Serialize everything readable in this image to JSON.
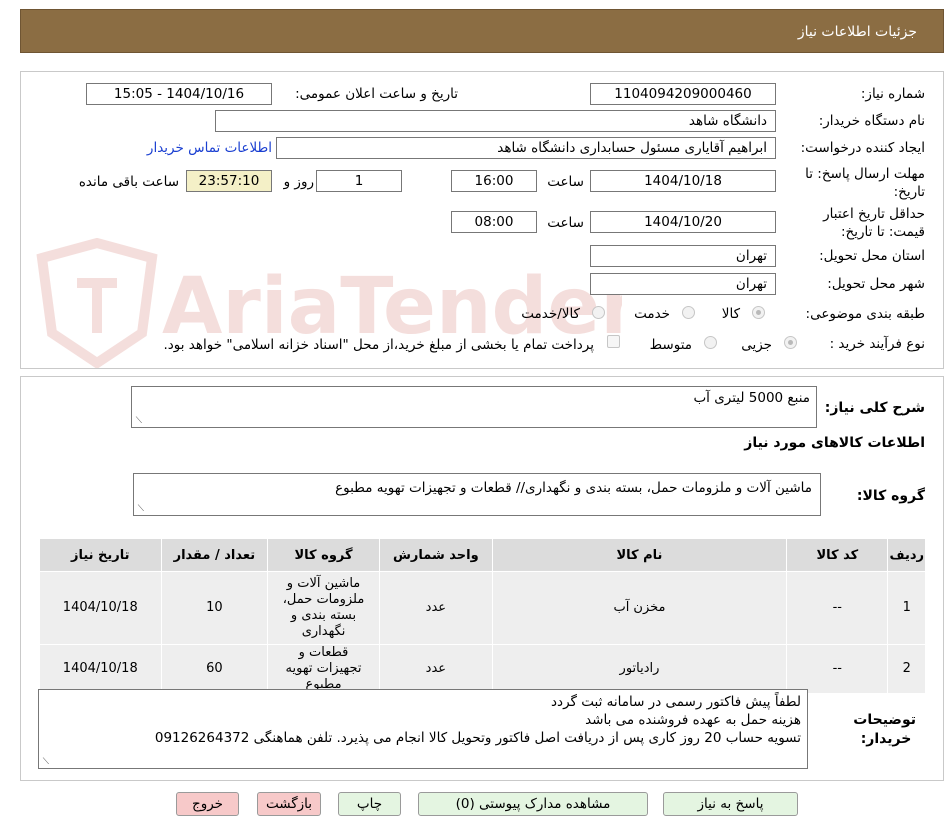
{
  "header": {
    "title": "جزئیات اطلاعات نیاز"
  },
  "form": {
    "need_number_label": "شماره نیاز:",
    "need_number": "1104094209000460",
    "announce_label": "تاریخ و ساعت اعلان عمومی:",
    "announce_value": "1404/10/16 - 15:05",
    "buyer_org_label": "نام دستگاه خریدار:",
    "buyer_org": "دانشگاه شاهد",
    "requester_label": "ایجاد کننده درخواست:",
    "requester": "ابراهیم آقایاری مسئول حسابداری دانشگاه شاهد",
    "contact_link": "اطلاعات تماس خریدار",
    "deadline_label": "مهلت ارسال پاسخ: تا تاریخ:",
    "deadline_date": "1404/10/18",
    "time_label": "ساعت",
    "deadline_time": "16:00",
    "days_value": "1",
    "days_label": "روز و",
    "remaining_time": "23:57:10",
    "remaining_label": "ساعت باقی مانده",
    "validity_label": "حداقل تاریخ اعتبار قیمت: تا تاریخ:",
    "validity_date": "1404/10/20",
    "validity_time": "08:00",
    "province_label": "استان محل تحویل:",
    "province": "تهران",
    "city_label": "شهر محل تحویل:",
    "city": "تهران",
    "category_label": "طبقه بندی موضوعی:",
    "category_options": [
      "کالا",
      "خدمت",
      "کالا/خدمت"
    ],
    "category_selected": "کالا",
    "process_label": "نوع فرآیند خرید :",
    "process_options": [
      "جزیی",
      "متوسط"
    ],
    "process_selected": "جزیی",
    "payment_note": "پرداخت تمام یا بخشی از مبلغ خرید،از محل \"اسناد خزانه اسلامی\" خواهد بود."
  },
  "details": {
    "summary_label": "شرح کلی نیاز:",
    "summary": "منبع 5000 لیتری آب",
    "goods_info_title": "اطلاعات کالاهای مورد نیاز",
    "goods_group_label": "گروه کالا:",
    "goods_group": "ماشین آلات و ملزومات حمل، بسته بندی و نگهداری//  قطعات و تجهیزات تهویه مطبوع",
    "table": {
      "headers": [
        "ردیف",
        "کد کالا",
        "نام کالا",
        "واحد شمارش",
        "گروه کالا",
        "تعداد / مقدار",
        "تاریخ نیاز"
      ],
      "rows": [
        [
          "1",
          "--",
          "مخزن آب",
          "عدد",
          "ماشین آلات و ملزومات حمل، بسته بندی و نگهداری",
          "10",
          "1404/10/18"
        ],
        [
          "2",
          "--",
          "رادیاتور",
          "عدد",
          "قطعات و تجهیزات تهویه مطبوع",
          "60",
          "1404/10/18"
        ]
      ]
    },
    "buyer_notes_label": "توضیحات خریدار:",
    "buyer_notes": [
      "لطفاً پیش فاکتور رسمی در سامانه ثبت گردد",
      "هزینه حمل به عهده فروشنده می باشد",
      "تسویه حساب 20 روز کاری پس از دریافت اصل فاکتور وتحویل کالا انجام می پذیرد. تلفن هماهنگی 09126264372"
    ]
  },
  "buttons": {
    "reply": "پاسخ به نیاز",
    "attachments": "مشاهده مدارک پیوستی (0)",
    "print": "چاپ",
    "back": "بازگشت",
    "exit": "خروج"
  },
  "watermark": {
    "text": "AriaTender.neT",
    "color": "#c0392b"
  },
  "colors": {
    "header_bg": "#8b6d43",
    "link": "#1a3fd1",
    "timer_bg": "#f4f0c7",
    "btn_green": "#e4f5e1",
    "btn_pink": "#f7c9c9"
  }
}
